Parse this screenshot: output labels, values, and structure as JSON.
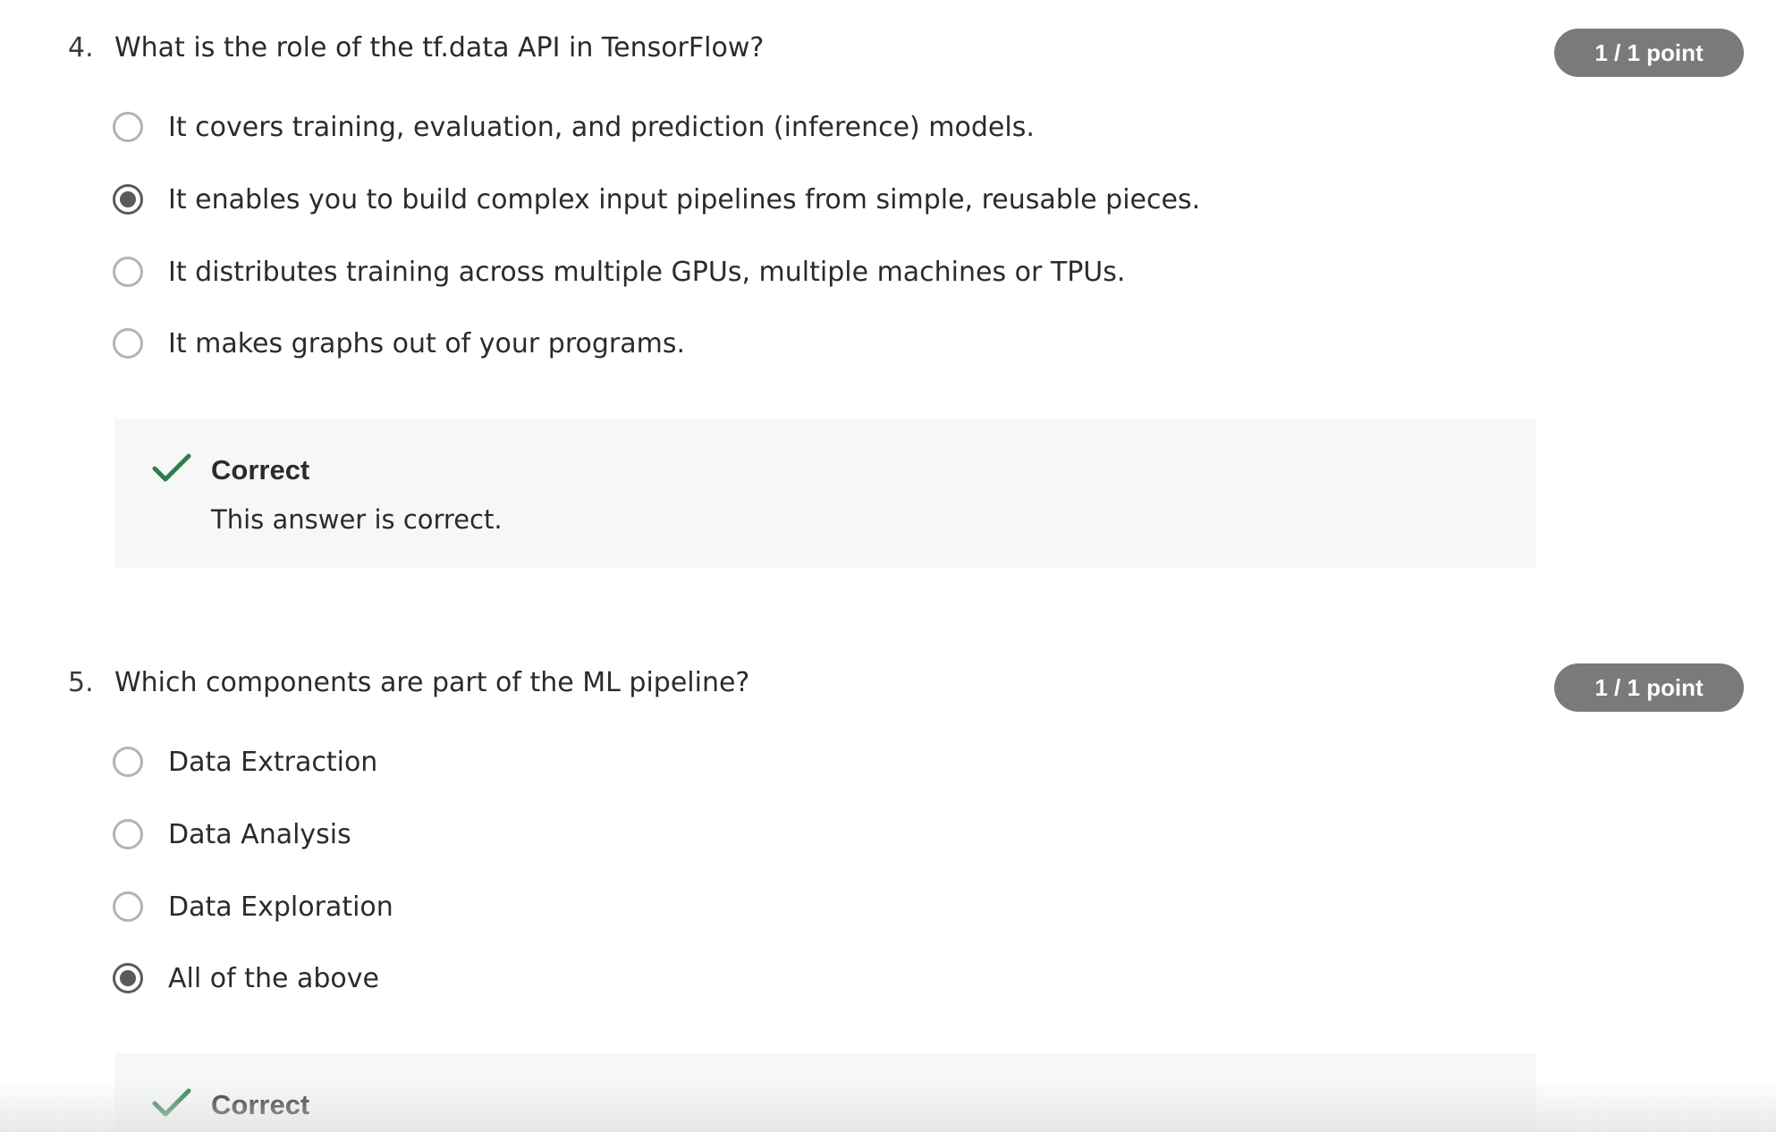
{
  "questions": [
    {
      "number": "4.",
      "text": "What is the role of the tf.data API in TensorFlow?",
      "points": "1 / 1 point",
      "options": [
        {
          "label": "It covers training, evaluation, and prediction (inference) models.",
          "selected": false
        },
        {
          "label": "It enables you to build complex input pipelines from simple, reusable pieces.",
          "selected": true
        },
        {
          "label": "It distributes training across multiple GPUs, multiple machines or TPUs.",
          "selected": false
        },
        {
          "label": "It makes graphs out of your programs.",
          "selected": false
        }
      ],
      "feedback": {
        "title": "Correct",
        "text": "This answer is correct."
      }
    },
    {
      "number": "5.",
      "text": "Which components are part of the ML pipeline?",
      "points": "1 / 1 point",
      "options": [
        {
          "label": "Data Extraction",
          "selected": false
        },
        {
          "label": "Data Analysis",
          "selected": false
        },
        {
          "label": "Data Exploration",
          "selected": false
        },
        {
          "label": "All of the above",
          "selected": true
        }
      ],
      "feedback": {
        "title": "Correct"
      }
    }
  ],
  "colors": {
    "badge_bg": "#7a7a7a",
    "check_green": "#2e7d4f",
    "feedback_bg": "#f6f8f7"
  },
  "icons": {
    "check": "check-icon",
    "radio": "radio-icon"
  }
}
